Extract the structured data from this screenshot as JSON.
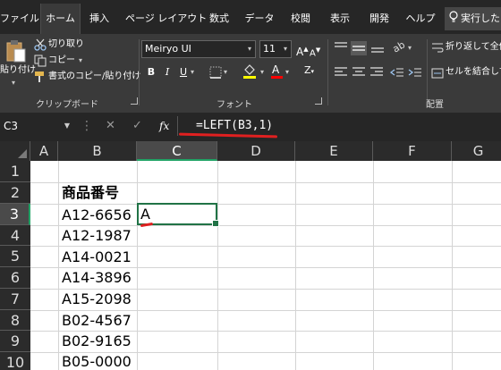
{
  "ribbon_tabs": [
    {
      "label": "ファイル",
      "active": false
    },
    {
      "label": "ホーム",
      "active": true
    },
    {
      "label": "挿入",
      "active": false
    },
    {
      "label": "ページ レイアウト",
      "active": false
    },
    {
      "label": "数式",
      "active": false
    },
    {
      "label": "データ",
      "active": false
    },
    {
      "label": "校閲",
      "active": false
    },
    {
      "label": "表示",
      "active": false
    },
    {
      "label": "開発",
      "active": false
    },
    {
      "label": "ヘルプ",
      "active": false
    }
  ],
  "tell_me": "実行したい",
  "clipboard": {
    "paste_label": "貼り付け",
    "cut_label": "切り取り",
    "copy_label": "コピー",
    "format_painter_label": "書式のコピー/貼り付け",
    "group_label": "クリップボード"
  },
  "font": {
    "font_name": "Meiryo UI",
    "font_size": "11",
    "bold": "B",
    "italic": "I",
    "underline": "U",
    "group_label": "フォント",
    "highlight_color": "#ffff00",
    "font_color": "#ff0000"
  },
  "alignment": {
    "wrap_label": "折り返して全体",
    "merge_label": "セルを結合して",
    "group_label": "配置"
  },
  "formula_bar": {
    "name_box": "C3",
    "fx": "fx",
    "formula": "=LEFT(B3,1)"
  },
  "columns": [
    "A",
    "B",
    "C",
    "D",
    "E",
    "F",
    "G"
  ],
  "selected_column": "C",
  "rows": [
    "1",
    "2",
    "3",
    "4",
    "5",
    "6",
    "7",
    "8",
    "9",
    "10"
  ],
  "selected_row": "3",
  "cells": {
    "B2": "商品番号",
    "B3": "A12-6656",
    "B4": "A12-1987",
    "B5": "A14-0021",
    "B6": "A14-3896",
    "B7": "A15-2098",
    "B8": "B02-4567",
    "B9": "B02-9165",
    "B10": "B05-0000",
    "C3": "A"
  },
  "colors": {
    "selection_green": "#217346",
    "annotation_red": "#e02020"
  }
}
